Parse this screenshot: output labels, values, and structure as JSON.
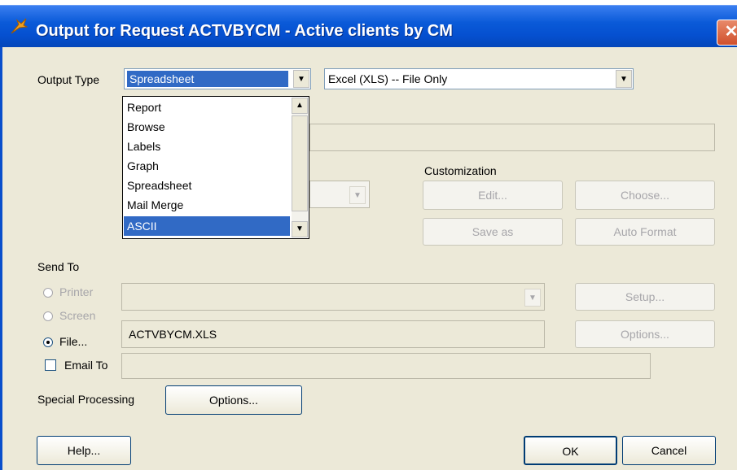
{
  "window": {
    "title": "Output for Request ACTVBYCM - Active clients by CM",
    "close_glyph": "✕"
  },
  "output_type": {
    "label": "Output Type",
    "selected": "Spreadsheet",
    "options": [
      "Report",
      "Browse",
      "Labels",
      "Graph",
      "Spreadsheet",
      "Mail Merge",
      "ASCII"
    ],
    "highlighted": "ASCII",
    "format_selected": "Excel (XLS) -- File Only"
  },
  "customization": {
    "label": "Customization",
    "edit_label": "Edit...",
    "choose_label": "Choose...",
    "save_as_label": "Save as",
    "auto_format_label": "Auto Format"
  },
  "send_to": {
    "label": "Send To",
    "printer_label": "Printer",
    "screen_label": "Screen",
    "file_label": "File...",
    "email_label": "Email To",
    "file_value": "ACTVBYCM.XLS",
    "setup_label": "Setup...",
    "options_label": "Options..."
  },
  "special_processing": {
    "label": "Special Processing",
    "options_label": "Options..."
  },
  "footer": {
    "help_label": "Help...",
    "ok_label": "OK",
    "cancel_label": "Cancel"
  },
  "colors": {
    "titlebar": "#0550d0",
    "selection": "#316ac5",
    "dialog_bg": "#ece9d8"
  },
  "icons": [
    "app-icon",
    "close-icon",
    "dropdown-arrow-icon",
    "scroll-up-icon",
    "scroll-down-icon"
  ]
}
